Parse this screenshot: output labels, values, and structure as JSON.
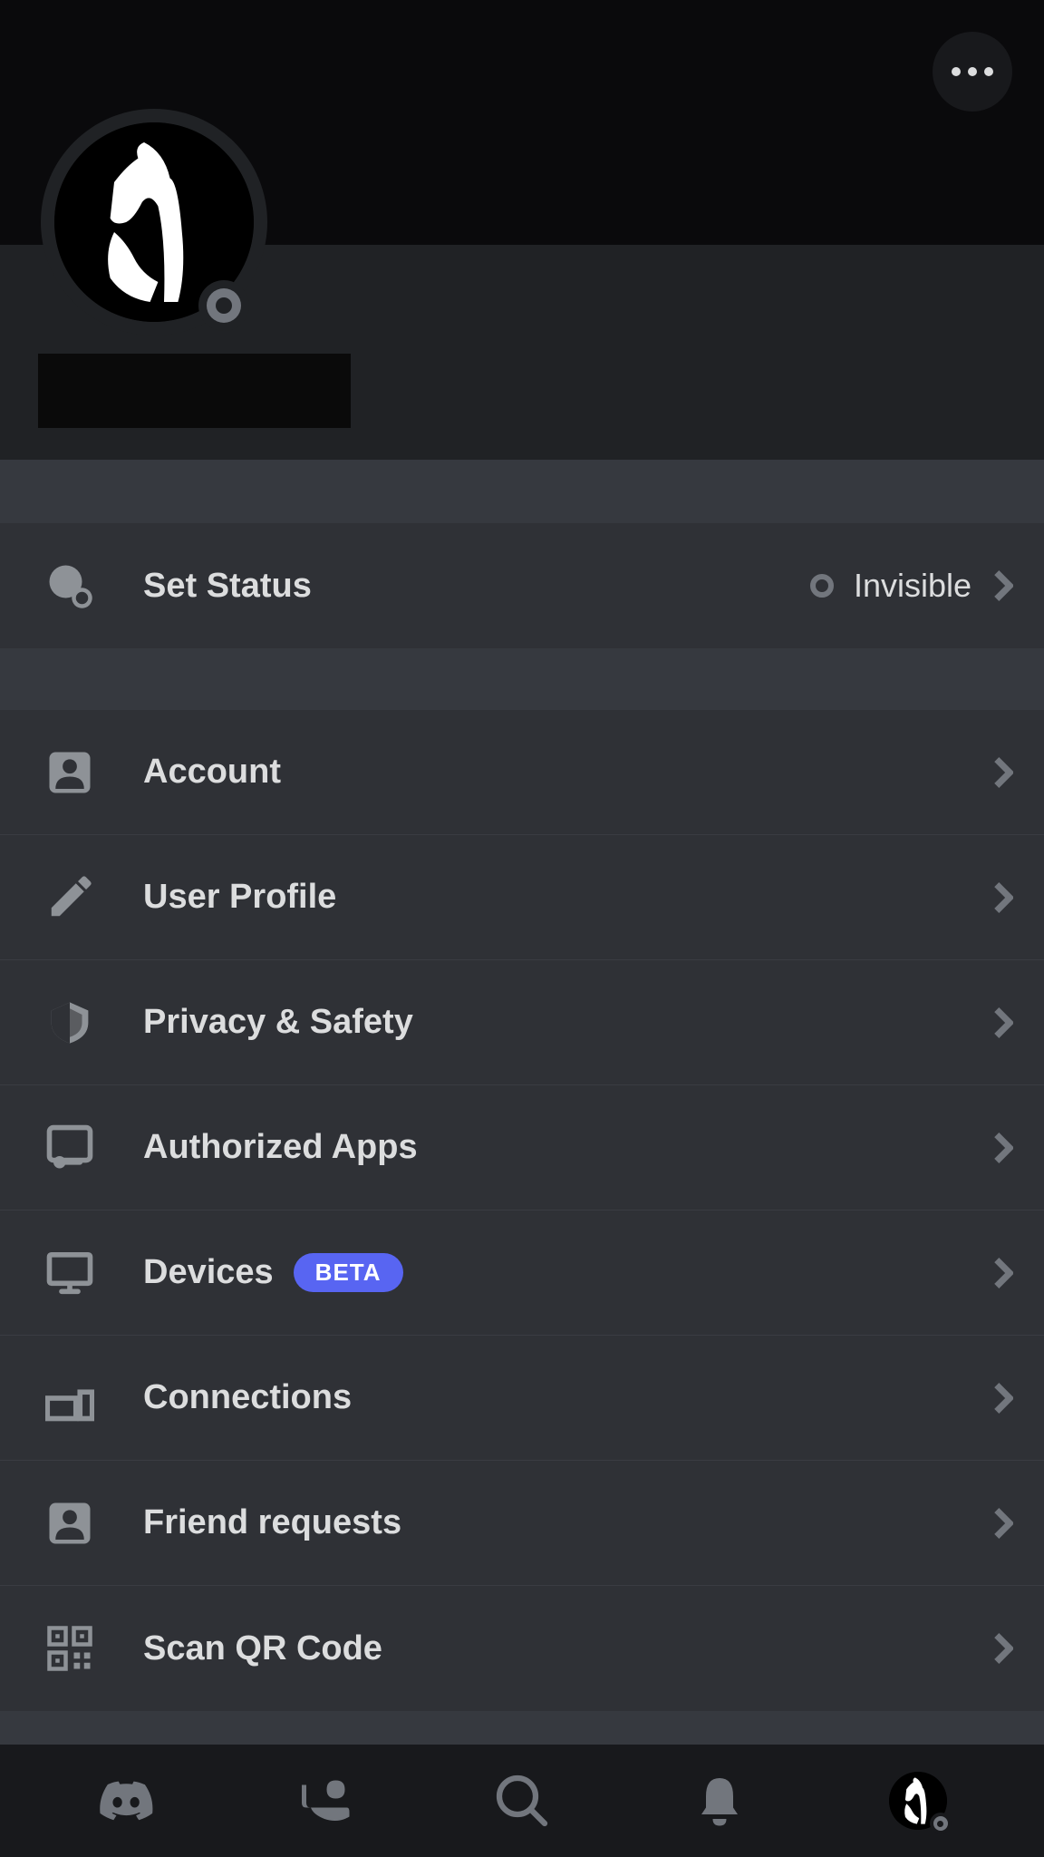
{
  "status_row": {
    "label": "Set Status",
    "value": "Invisible"
  },
  "settings": {
    "items": [
      {
        "label": "Account"
      },
      {
        "label": "User Profile"
      },
      {
        "label": "Privacy & Safety"
      },
      {
        "label": "Authorized Apps"
      },
      {
        "label": "Devices",
        "badge": "BETA"
      },
      {
        "label": "Connections"
      },
      {
        "label": "Friend requests"
      },
      {
        "label": "Scan QR Code"
      }
    ]
  },
  "colors": {
    "accent": "#5865f2",
    "bg_primary": "#36393f",
    "bg_secondary": "#2f3136",
    "bg_tertiary": "#202225",
    "bg_banner": "#0a0a0c"
  }
}
